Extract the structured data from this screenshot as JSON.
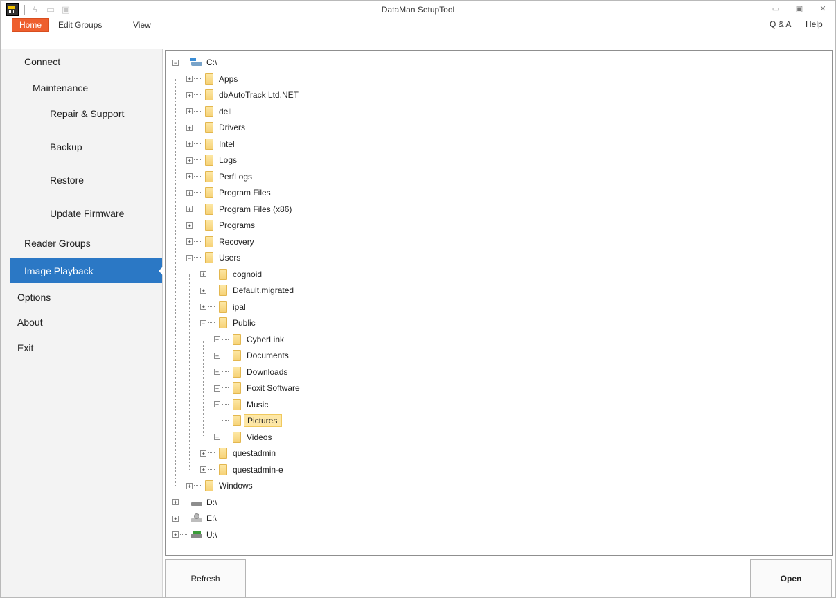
{
  "window": {
    "title": "DataMan SetupTool"
  },
  "quick_access": [
    {
      "icon": "app-icon"
    },
    {
      "icon": "lightning-icon"
    },
    {
      "icon": "monitor-icon"
    },
    {
      "icon": "device-icon"
    }
  ],
  "ribbon": {
    "tabs": [
      {
        "label": "Home",
        "active": true
      },
      {
        "label": "Edit Groups",
        "active": false
      },
      {
        "label": "View",
        "active": false
      }
    ],
    "right_tabs": [
      "Q & A",
      "Help"
    ]
  },
  "sidebar": {
    "items": [
      {
        "label": "Connect",
        "level": 0
      },
      {
        "label": "Maintenance",
        "level": 1
      },
      {
        "label": "Repair & Support",
        "level": 2
      },
      {
        "label": "Backup",
        "level": 2
      },
      {
        "label": "Restore",
        "level": 2
      },
      {
        "label": "Update Firmware",
        "level": 2
      },
      {
        "label": "Reader Groups",
        "level": 1
      },
      {
        "label": "Image Playback",
        "level": 1,
        "active": true
      },
      {
        "label": "Options",
        "level": 0
      },
      {
        "label": "About",
        "level": 0
      },
      {
        "label": "Exit",
        "level": 0
      }
    ]
  },
  "tree": {
    "nodes": [
      {
        "label": "C:\\",
        "depth": 0,
        "type": "drive-c",
        "expander": "-"
      },
      {
        "label": "Apps",
        "depth": 1,
        "type": "folder",
        "expander": "+"
      },
      {
        "label": "dbAutoTrack Ltd.NET",
        "depth": 1,
        "type": "folder",
        "expander": "+"
      },
      {
        "label": "dell",
        "depth": 1,
        "type": "folder",
        "expander": "+"
      },
      {
        "label": "Drivers",
        "depth": 1,
        "type": "folder",
        "expander": "+"
      },
      {
        "label": "Intel",
        "depth": 1,
        "type": "folder",
        "expander": "+"
      },
      {
        "label": "Logs",
        "depth": 1,
        "type": "folder",
        "expander": "+"
      },
      {
        "label": "PerfLogs",
        "depth": 1,
        "type": "folder",
        "expander": "+"
      },
      {
        "label": "Program Files",
        "depth": 1,
        "type": "folder",
        "expander": "+"
      },
      {
        "label": "Program Files (x86)",
        "depth": 1,
        "type": "folder",
        "expander": "+"
      },
      {
        "label": "Programs",
        "depth": 1,
        "type": "folder",
        "expander": "+"
      },
      {
        "label": "Recovery",
        "depth": 1,
        "type": "folder",
        "expander": "+"
      },
      {
        "label": "Users",
        "depth": 1,
        "type": "folder",
        "expander": "-"
      },
      {
        "label": "cognoid",
        "depth": 2,
        "type": "folder",
        "expander": "+"
      },
      {
        "label": "Default.migrated",
        "depth": 2,
        "type": "folder",
        "expander": "+"
      },
      {
        "label": "ipal",
        "depth": 2,
        "type": "folder",
        "expander": "+"
      },
      {
        "label": "Public",
        "depth": 2,
        "type": "folder",
        "expander": "-"
      },
      {
        "label": "CyberLink",
        "depth": 3,
        "type": "folder",
        "expander": "+"
      },
      {
        "label": "Documents",
        "depth": 3,
        "type": "folder",
        "expander": "+"
      },
      {
        "label": "Downloads",
        "depth": 3,
        "type": "folder",
        "expander": "+"
      },
      {
        "label": "Foxit Software",
        "depth": 3,
        "type": "folder",
        "expander": "+"
      },
      {
        "label": "Music",
        "depth": 3,
        "type": "folder",
        "expander": "+"
      },
      {
        "label": "Pictures",
        "depth": 3,
        "type": "folder",
        "expander": "",
        "selected": true
      },
      {
        "label": "Videos",
        "depth": 3,
        "type": "folder",
        "expander": "+"
      },
      {
        "label": "questadmin",
        "depth": 2,
        "type": "folder",
        "expander": "+"
      },
      {
        "label": "questadmin-e",
        "depth": 2,
        "type": "folder",
        "expander": "+"
      },
      {
        "label": "Windows",
        "depth": 1,
        "type": "folder",
        "expander": "+"
      },
      {
        "label": "D:\\",
        "depth": 0,
        "type": "drive-d",
        "expander": "+"
      },
      {
        "label": "E:\\",
        "depth": 0,
        "type": "drive-e",
        "expander": "+"
      },
      {
        "label": "U:\\",
        "depth": 0,
        "type": "drive-u",
        "expander": "+"
      }
    ]
  },
  "buttons": {
    "refresh": "Refresh",
    "open": "Open"
  }
}
